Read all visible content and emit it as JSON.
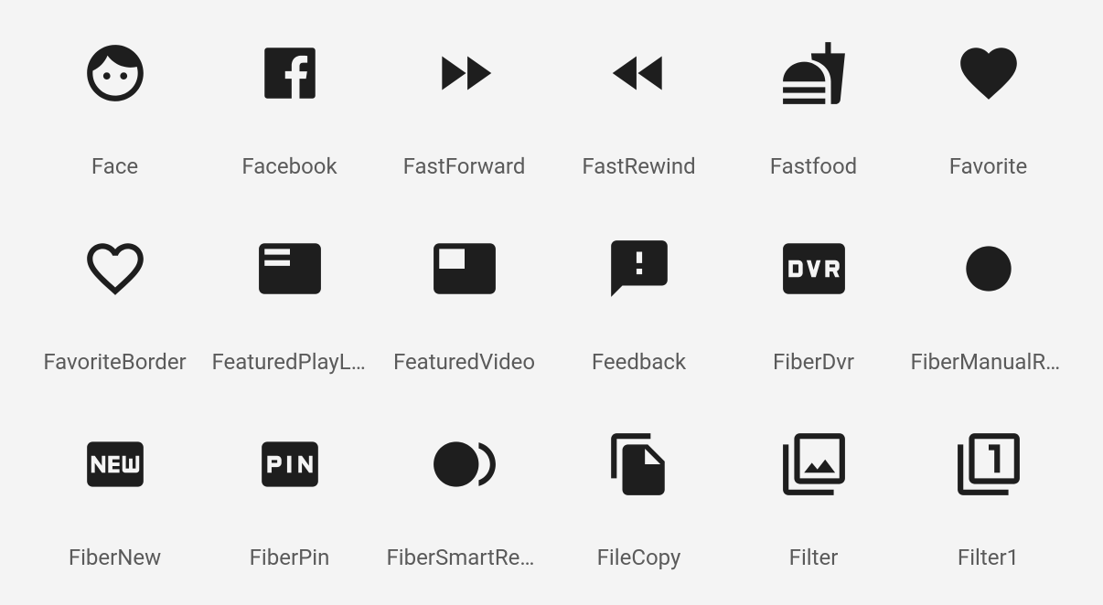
{
  "icons": [
    {
      "key": "face",
      "label": "Face"
    },
    {
      "key": "facebook",
      "label": "Facebook"
    },
    {
      "key": "fastforward",
      "label": "FastForward"
    },
    {
      "key": "fastrewind",
      "label": "FastRewind"
    },
    {
      "key": "fastfood",
      "label": "Fastfood"
    },
    {
      "key": "favorite",
      "label": "Favorite"
    },
    {
      "key": "favoriteborder",
      "label": "FavoriteBorder"
    },
    {
      "key": "featuredplaylist",
      "label": "FeaturedPlayList"
    },
    {
      "key": "featuredvideo",
      "label": "FeaturedVideo"
    },
    {
      "key": "feedback",
      "label": "Feedback"
    },
    {
      "key": "fiberdvr",
      "label": "FiberDvr"
    },
    {
      "key": "fibermanualrecord",
      "label": "FiberManualRecord"
    },
    {
      "key": "fibernew",
      "label": "FiberNew"
    },
    {
      "key": "fiberpin",
      "label": "FiberPin"
    },
    {
      "key": "fibersmartrecord",
      "label": "FiberSmartRecord"
    },
    {
      "key": "filecopy",
      "label": "FileCopy"
    },
    {
      "key": "filter",
      "label": "Filter"
    },
    {
      "key": "filter1",
      "label": "Filter1"
    }
  ]
}
